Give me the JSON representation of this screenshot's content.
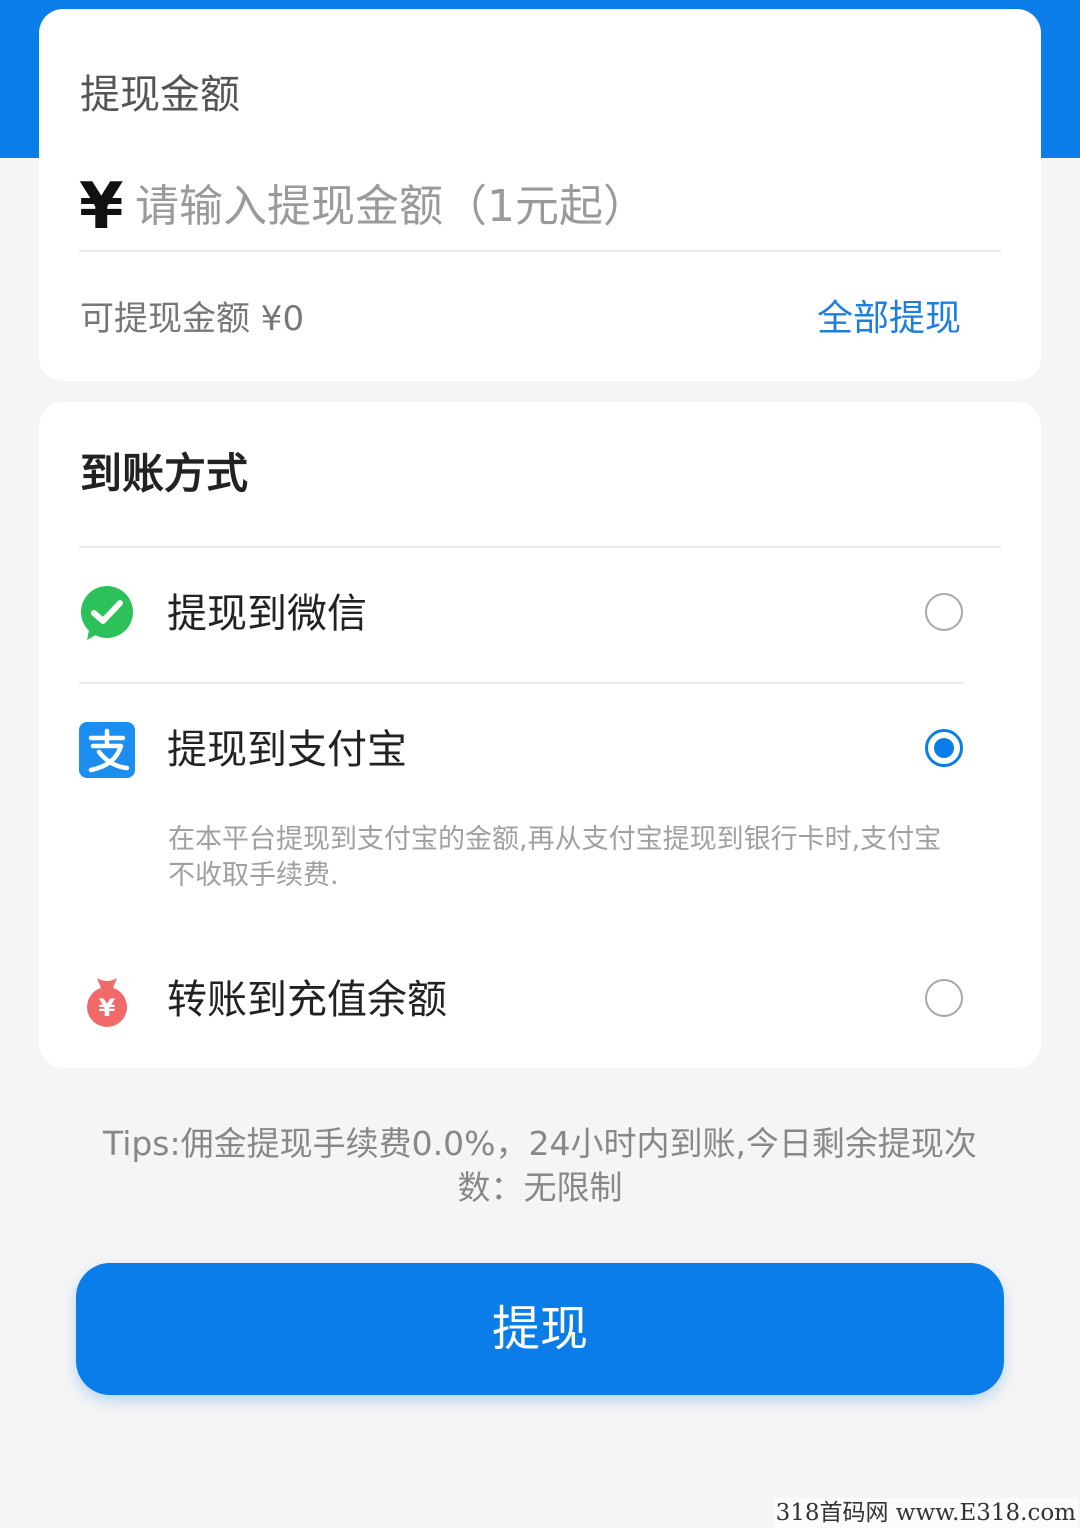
{
  "amount_card": {
    "title": "提现金额",
    "currency_symbol": "¥",
    "input_placeholder": "请输入提现金额（1元起）",
    "input_value": "",
    "available_text": "可提现金额 ¥0",
    "withdraw_all_label": "全部提现"
  },
  "method_card": {
    "title": "到账方式",
    "options": [
      {
        "label": "提现到微信",
        "icon": "wechat-icon",
        "selected": false
      },
      {
        "label": "提现到支付宝",
        "icon": "alipay-icon",
        "selected": true
      },
      {
        "label": "转账到充值余额",
        "icon": "money-bag-icon",
        "selected": false
      }
    ],
    "alipay_note": "在本平台提现到支付宝的金额,再从支付宝提现到银行卡时,支付宝不收取手续费."
  },
  "tips": "Tips:佣金提现手续费0.0%，24小时内到账,今日剩余提现次数：无限制",
  "submit_label": "提现",
  "watermark": "318首码网 www.E318.com",
  "colors": {
    "primary": "#0a7de8",
    "link": "#1e7ee0",
    "wechat": "#2dc15a",
    "alipay": "#1b8ef0",
    "money_bag": "#f06a6a",
    "background": "#f5f5f5"
  }
}
